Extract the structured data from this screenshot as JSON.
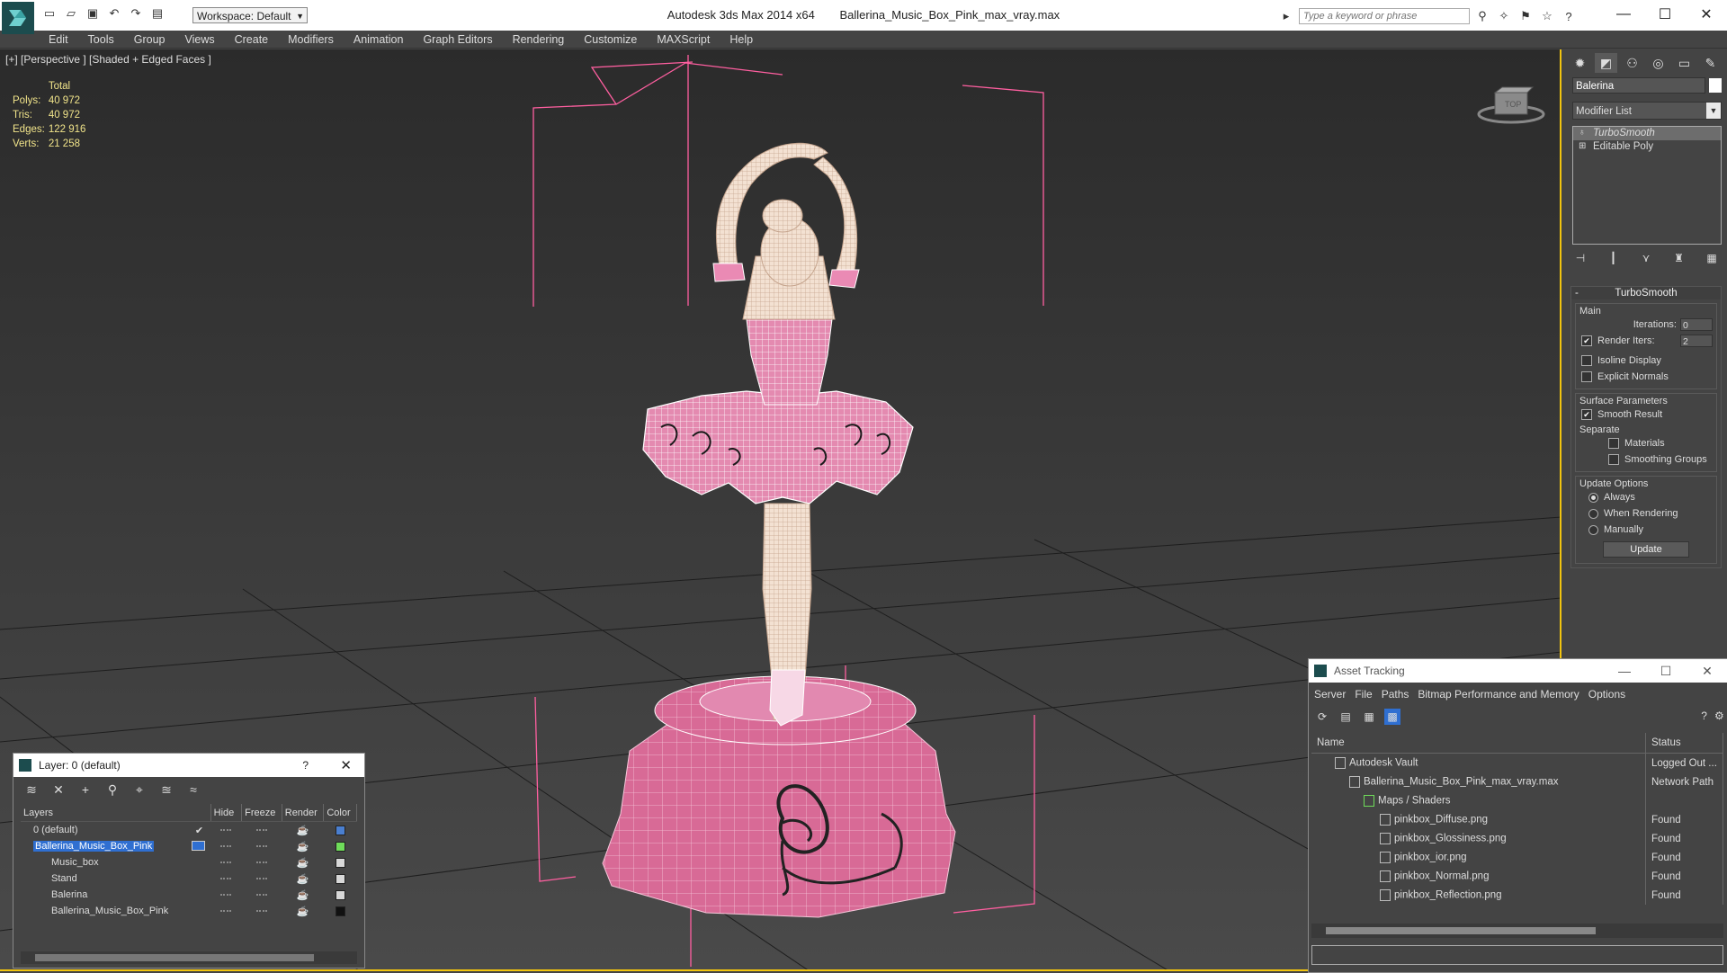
{
  "app": {
    "title": "Autodesk 3ds Max  2014 x64",
    "file": "Ballerina_Music_Box_Pink_max_vray.max",
    "workspace": "Workspace: Default",
    "search_placeholder": "Type a keyword or phrase"
  },
  "menu": [
    "Edit",
    "Tools",
    "Group",
    "Views",
    "Create",
    "Modifiers",
    "Animation",
    "Graph Editors",
    "Rendering",
    "Customize",
    "MAXScript",
    "Help"
  ],
  "viewport": {
    "label": "[+] [Perspective ] [Shaded + Edged Faces ]",
    "stats": {
      "header": "Total",
      "rows": [
        {
          "label": "Polys:",
          "value": "40 972"
        },
        {
          "label": "Tris:",
          "value": "40 972"
        },
        {
          "label": "Edges:",
          "value": "122 916"
        },
        {
          "label": "Verts:",
          "value": "21 258"
        }
      ]
    },
    "viewcube_label": "TOP"
  },
  "command_panel": {
    "object_name": "Balerina",
    "modifier_list": "Modifier List",
    "stack": [
      "TurboSmooth",
      "Editable Poly"
    ],
    "turbosmooth": {
      "title": "TurboSmooth",
      "main_label": "Main",
      "iterations_label": "Iterations:",
      "iterations_value": "0",
      "render_iters_label": "Render Iters:",
      "render_iters_value": "2",
      "isoline_label": "Isoline Display",
      "explicit_normals_label": "Explicit Normals",
      "surface_params_label": "Surface Parameters",
      "smooth_result_label": "Smooth Result",
      "separate_label": "Separate",
      "materials_label": "Materials",
      "smoothing_groups_label": "Smoothing Groups",
      "update_options_label": "Update Options",
      "always_label": "Always",
      "when_rendering_label": "When Rendering",
      "manually_label": "Manually",
      "update_button": "Update"
    }
  },
  "layer_dialog": {
    "title": "Layer: 0 (default)",
    "help": "?",
    "columns": [
      "Layers",
      "Hide",
      "Freeze",
      "Render",
      "Color"
    ],
    "rows": [
      {
        "name": "0 (default)",
        "color": "#4a7fd0"
      },
      {
        "name": "Ballerina_Music_Box_Pink",
        "color": "#6fdc5a"
      },
      {
        "name": "Music_box",
        "color": "#d8d8d8"
      },
      {
        "name": "Stand",
        "color": "#d8d8d8"
      },
      {
        "name": "Balerina",
        "color": "#d8d8d8"
      },
      {
        "name": "Ballerina_Music_Box_Pink",
        "color": "#111111"
      }
    ]
  },
  "asset_tracking": {
    "title": "Asset Tracking",
    "menu": [
      "Server",
      "File",
      "Paths",
      "Bitmap Performance and Memory",
      "Options"
    ],
    "columns": [
      "Name",
      "Status"
    ],
    "rows": [
      {
        "name": "Autodesk Vault",
        "status": "Logged Out ..."
      },
      {
        "name": "Ballerina_Music_Box_Pink_max_vray.max",
        "status": "Network Path"
      },
      {
        "name": "Maps / Shaders",
        "status": ""
      },
      {
        "name": "pinkbox_Diffuse.png",
        "status": "Found"
      },
      {
        "name": "pinkbox_Glossiness.png",
        "status": "Found"
      },
      {
        "name": "pinkbox_ior.png",
        "status": "Found"
      },
      {
        "name": "pinkbox_Normal.png",
        "status": "Found"
      },
      {
        "name": "pinkbox_Reflection.png",
        "status": "Found"
      }
    ]
  },
  "colors": {
    "viewport_active_border": "#f1c40f",
    "selection_pink": "#ff5fa0",
    "model_pink": "#e07aa8",
    "stats_text": "#f1e48a"
  }
}
